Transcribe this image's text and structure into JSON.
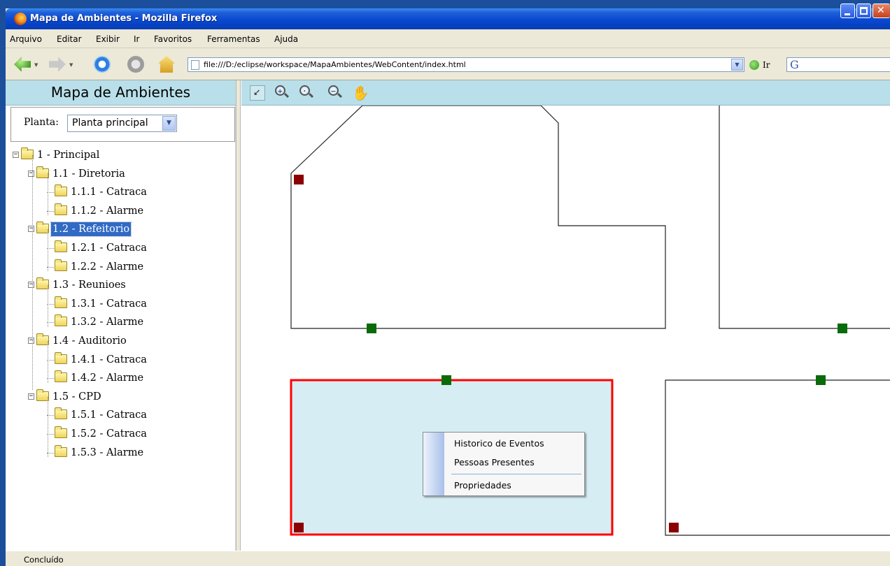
{
  "window": {
    "title": "Mapa de Ambientes - Mozilla Firefox"
  },
  "menu": {
    "items": [
      "Arquivo",
      "Editar",
      "Exibir",
      "Ir",
      "Favoritos",
      "Ferramentas",
      "Ajuda"
    ]
  },
  "navbar": {
    "url": "file:///D:/eclipse/workspace/MapaAmbientes/WebContent/index.html",
    "go_label": "Ir",
    "search_engine": "G"
  },
  "sidebar": {
    "title": "Mapa de Ambientes",
    "planta_label": "Planta:",
    "planta_value": "Planta principal"
  },
  "tree": [
    {
      "label": "1 - Principal",
      "level": 0,
      "expanded": true
    },
    {
      "label": "1.1 - Diretoria",
      "level": 1,
      "expanded": true
    },
    {
      "label": "1.1.1 - Catraca",
      "level": 2
    },
    {
      "label": "1.1.2 - Alarme",
      "level": 2
    },
    {
      "label": "1.2 - Refeitorio",
      "level": 1,
      "expanded": true,
      "selected": true
    },
    {
      "label": "1.2.1 - Catraca",
      "level": 2
    },
    {
      "label": "1.2.2 - Alarme",
      "level": 2
    },
    {
      "label": "1.3 - Reunioes",
      "level": 1,
      "expanded": true
    },
    {
      "label": "1.3.1 - Catraca",
      "level": 2
    },
    {
      "label": "1.3.2 - Alarme",
      "level": 2
    },
    {
      "label": "1.4 - Auditorio",
      "level": 1,
      "expanded": true
    },
    {
      "label": "1.4.1 - Catraca",
      "level": 2
    },
    {
      "label": "1.4.2 - Alarme",
      "level": 2
    },
    {
      "label": "1.5 - CPD",
      "level": 1,
      "expanded": true
    },
    {
      "label": "1.5.1 - Catraca",
      "level": 2
    },
    {
      "label": "1.5.2 - Catraca",
      "level": 2
    },
    {
      "label": "1.5.3 - Alarme",
      "level": 2
    }
  ],
  "map_tools": [
    "pointer-icon",
    "zoom-in-icon",
    "zoom-fit-icon",
    "zoom-out-icon",
    "hand-pan-icon"
  ],
  "map_colors": {
    "room_highlight_border": "#ff0000",
    "room_highlight_fill": "#d6edf3",
    "alarm_device": "#8b0000",
    "turnstile_device": "#0a6b0a"
  },
  "context_menu": {
    "items": [
      "Historico de Eventos",
      "Pessoas Presentes",
      "Propriedades"
    ]
  },
  "status": {
    "text": "Concluído"
  }
}
